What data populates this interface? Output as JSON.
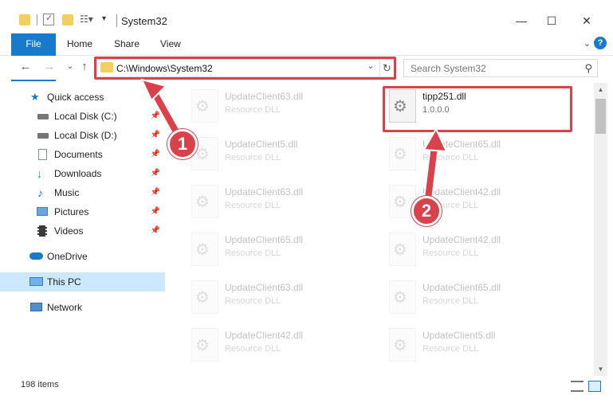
{
  "window": {
    "title": "System32"
  },
  "ribbon": {
    "tabs": [
      "File",
      "Home",
      "Share",
      "View"
    ]
  },
  "address": {
    "path": "C:\\Windows\\System32"
  },
  "search": {
    "placeholder": "Search System32"
  },
  "sidebar": {
    "items": [
      {
        "label": "Quick access",
        "icon": "star-icon"
      },
      {
        "label": "Local Disk (C:)",
        "icon": "drive-icon",
        "pinned": true
      },
      {
        "label": "Local Disk (D:)",
        "icon": "drive-icon",
        "pinned": true
      },
      {
        "label": "Documents",
        "icon": "documents-icon",
        "pinned": true
      },
      {
        "label": "Downloads",
        "icon": "download-icon",
        "pinned": true
      },
      {
        "label": "Music",
        "icon": "music-icon",
        "pinned": true
      },
      {
        "label": "Pictures",
        "icon": "pictures-icon",
        "pinned": true
      },
      {
        "label": "Videos",
        "icon": "videos-icon",
        "pinned": true
      },
      {
        "label": "OneDrive",
        "icon": "cloud-icon"
      },
      {
        "label": "This PC",
        "icon": "computer-icon",
        "selected": true
      },
      {
        "label": "Network",
        "icon": "network-icon"
      }
    ]
  },
  "files": {
    "highlighted": {
      "name": "tipp251.dll",
      "desc": "1.0.0.0"
    },
    "left": [
      {
        "name": "UpdateClient63.dll",
        "desc": "Resource DLL"
      },
      {
        "name": "UpdateClient5.dll",
        "desc": "Resource DLL"
      },
      {
        "name": "UpdateClient63.dll",
        "desc": "Resource DLL"
      },
      {
        "name": "UpdateClient65.dll",
        "desc": "Resource DLL"
      },
      {
        "name": "UpdateClient63.dll",
        "desc": "Resource DLL"
      },
      {
        "name": "UpdateClient42.dll",
        "desc": "Resource DLL"
      }
    ],
    "right": [
      {
        "name": "UpdateClient65.dll",
        "desc": "Resource DLL"
      },
      {
        "name": "UpdateClient42.dll",
        "desc": "Resource DLL"
      },
      {
        "name": "UpdateClient42.dll",
        "desc": "Resource DLL"
      },
      {
        "name": "UpdateClient65.dll",
        "desc": "Resource DLL"
      },
      {
        "name": "UpdateClient5.dll",
        "desc": "Resource DLL"
      }
    ]
  },
  "status": {
    "items": "198 items"
  },
  "annotations": {
    "badge1": "1",
    "badge2": "2"
  },
  "colors": {
    "accent": "#1979ca",
    "annotation": "#d9414b",
    "selected": "#cce8ff"
  }
}
